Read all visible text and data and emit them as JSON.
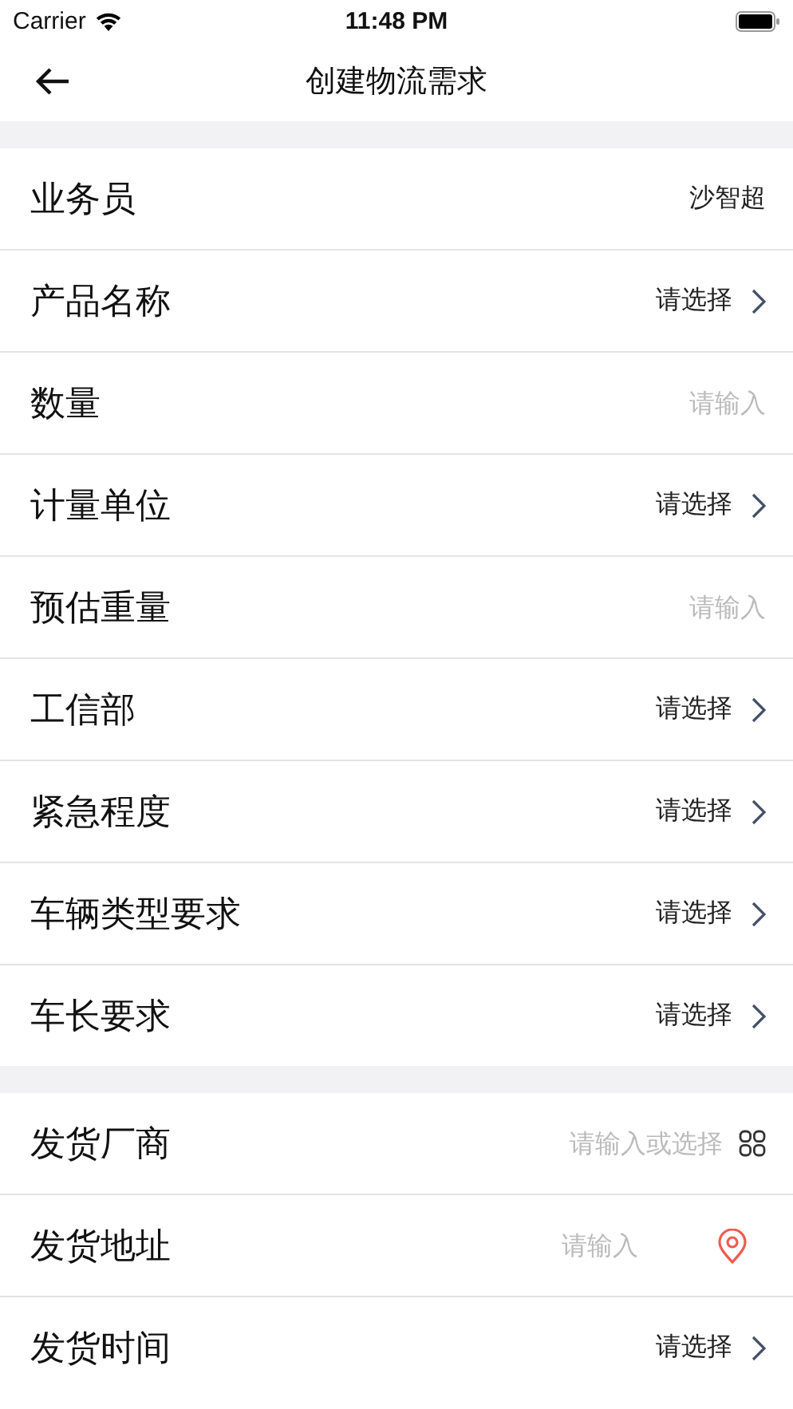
{
  "status_bar": {
    "carrier": "Carrier",
    "time": "11:48 PM"
  },
  "nav": {
    "title": "创建物流需求"
  },
  "sections": [
    {
      "rows": [
        {
          "label": "业务员",
          "kind": "value",
          "value": "沙智超"
        },
        {
          "label": "产品名称",
          "kind": "select",
          "value": "请选择"
        },
        {
          "label": "数量",
          "kind": "input",
          "placeholder": "请输入"
        },
        {
          "label": "计量单位",
          "kind": "select",
          "value": "请选择"
        },
        {
          "label": "预估重量",
          "kind": "input",
          "placeholder": "请输入"
        },
        {
          "label": "工信部",
          "kind": "select",
          "value": "请选择"
        },
        {
          "label": "紧急程度",
          "kind": "select",
          "value": "请选择"
        },
        {
          "label": "车辆类型要求",
          "kind": "select",
          "value": "请选择"
        },
        {
          "label": "车长要求",
          "kind": "select",
          "value": "请选择"
        }
      ]
    },
    {
      "rows": [
        {
          "label": "发货厂商",
          "kind": "input-select",
          "placeholder": "请输入或选择"
        },
        {
          "label": "发货地址",
          "kind": "location",
          "placeholder": "请输入"
        },
        {
          "label": "发货时间",
          "kind": "select",
          "value": "请选择"
        }
      ]
    }
  ]
}
